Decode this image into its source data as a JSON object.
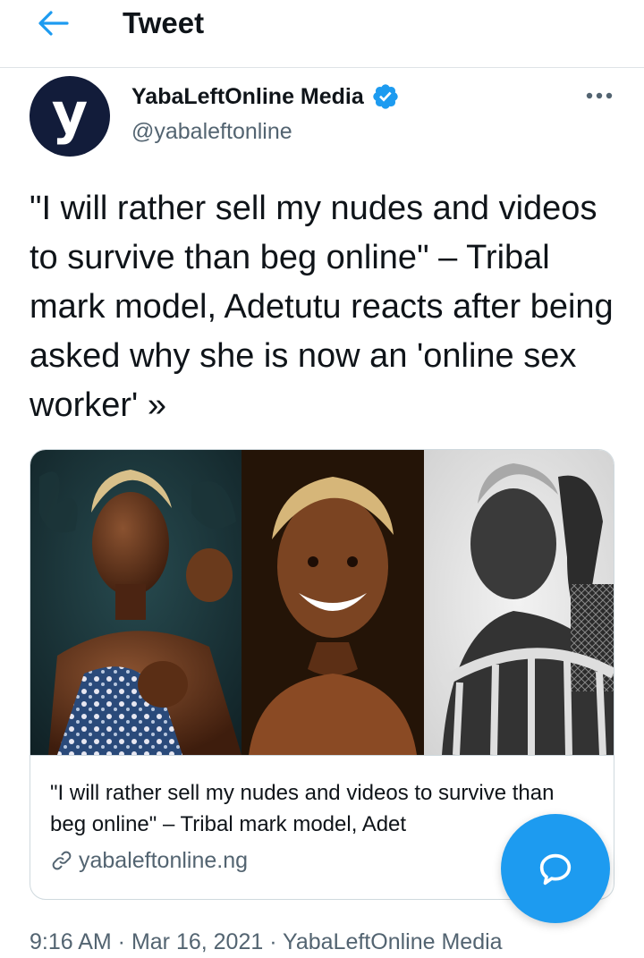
{
  "header": {
    "title": "Tweet",
    "back_icon": "arrow-left-icon"
  },
  "author": {
    "avatar_letter": "y",
    "name": "YabaLeftOnline Media",
    "handle": "@yabaleftonline",
    "verified": true
  },
  "tweet": {
    "text": "\"I will rather sell my nudes and videos to survive than beg online\" – Tribal mark model, Adetutu reacts after being asked why she is now an 'online sex worker' »",
    "timestamp": "9:16 AM · Mar 16, 2021 · YabaLeftOnline Media"
  },
  "card": {
    "title": "\"I will rather sell my nudes and videos to survive than beg online\" – Tribal mark model, Adet",
    "domain": "yabaleftonline.ng"
  },
  "colors": {
    "accent": "#1d9bf0",
    "text": "#0f1419",
    "muted": "#536471",
    "avatar_bg": "#121c3a"
  }
}
